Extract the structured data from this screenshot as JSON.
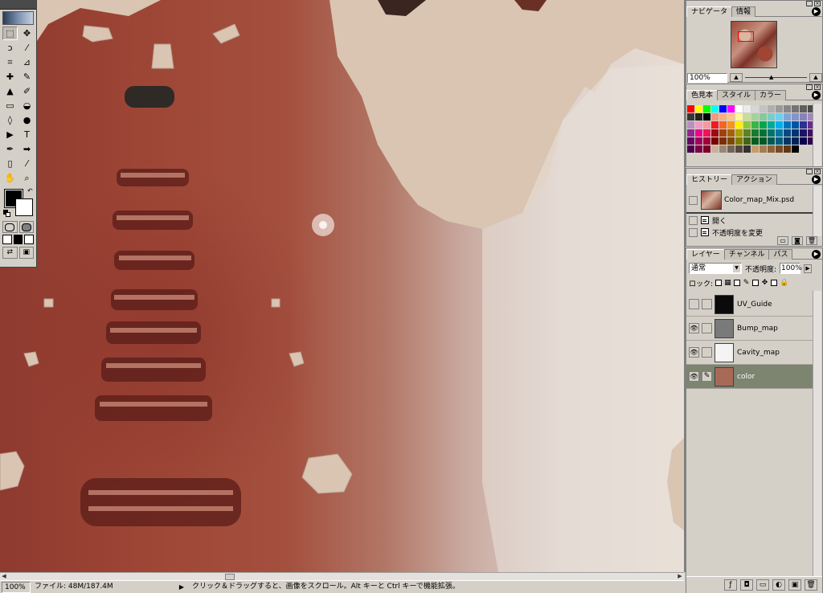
{
  "status": {
    "zoom": "100%",
    "file_info": "ファイル: 48M/187.4M",
    "message": "クリック＆ドラッグすると、画像をスクロール。Alt キーと Ctrl キーで機能拡張。"
  },
  "toolbox": {
    "tools": [
      {
        "icon": "marquee-icon",
        "glyph": "⬚"
      },
      {
        "icon": "move-icon",
        "glyph": "✥"
      },
      {
        "icon": "lasso-icon",
        "glyph": "ↄ"
      },
      {
        "icon": "magic-wand-icon",
        "glyph": "⁄"
      },
      {
        "icon": "crop-icon",
        "glyph": "⌗"
      },
      {
        "icon": "slice-icon",
        "glyph": "⊿"
      },
      {
        "icon": "healing-brush-icon",
        "glyph": "✚"
      },
      {
        "icon": "brush-icon",
        "glyph": "✎"
      },
      {
        "icon": "stamp-icon",
        "glyph": "▲"
      },
      {
        "icon": "history-brush-icon",
        "glyph": "✐"
      },
      {
        "icon": "eraser-icon",
        "glyph": "▭"
      },
      {
        "icon": "bucket-icon",
        "glyph": "◒"
      },
      {
        "icon": "blur-icon",
        "glyph": "◊"
      },
      {
        "icon": "dodge-icon",
        "glyph": "●"
      },
      {
        "icon": "path-select-icon",
        "glyph": "▶"
      },
      {
        "icon": "type-icon",
        "glyph": "T"
      },
      {
        "icon": "pen-icon",
        "glyph": "✒"
      },
      {
        "icon": "shape-icon",
        "glyph": "➡"
      },
      {
        "icon": "notes-icon",
        "glyph": "▯"
      },
      {
        "icon": "eyedropper-icon",
        "glyph": "⁄"
      },
      {
        "icon": "hand-icon",
        "glyph": "✋"
      },
      {
        "icon": "zoom-icon",
        "glyph": "⌕"
      }
    ]
  },
  "navigator": {
    "tabs": [
      "ナビゲータ",
      "情報"
    ],
    "zoom": "100%"
  },
  "swatches": {
    "tabs": [
      "色見本",
      "スタイル",
      "カラー"
    ],
    "colors": [
      "#ff0000",
      "#ffff00",
      "#00ff00",
      "#00ffff",
      "#0000ff",
      "#ff00ff",
      "#ffffff",
      "#ebebeb",
      "#d7d7d7",
      "#c3c3c3",
      "#afafaf",
      "#9b9b9b",
      "#878787",
      "#737373",
      "#5f5f5f",
      "#4b4b4b",
      "#373737",
      "#232323",
      "#000000",
      "#f7977a",
      "#f9ad81",
      "#fdc68a",
      "#fff79a",
      "#c4df9b",
      "#a2d39c",
      "#82ca9d",
      "#7bcdc8",
      "#6ecff6",
      "#7ea7d8",
      "#8493ca",
      "#8882be",
      "#a187be",
      "#bc8dbf",
      "#f49ac2",
      "#f6989d",
      "#ed1c24",
      "#f26522",
      "#f7941d",
      "#fff200",
      "#8dc73f",
      "#39b54a",
      "#00a651",
      "#00a99d",
      "#00aeef",
      "#0072bc",
      "#0054a6",
      "#2e3192",
      "#662d91",
      "#92278f",
      "#ec008c",
      "#ed145b",
      "#9e0b0f",
      "#a0410d",
      "#a36209",
      "#aba000",
      "#598527",
      "#1a7b30",
      "#007236",
      "#00746b",
      "#0076a3",
      "#004b80",
      "#003471",
      "#1b1464",
      "#440e62",
      "#630460",
      "#9e005d",
      "#9e0039",
      "#790000",
      "#7b2e00",
      "#7d4900",
      "#827b00",
      "#406618",
      "#005e20",
      "#005826",
      "#005952",
      "#005b7f",
      "#003663",
      "#002157",
      "#0d004c",
      "#32004b",
      "#4b0049",
      "#7b0046",
      "#7a0026",
      "#c7b299",
      "#998675",
      "#736357",
      "#534741",
      "#37302d",
      "#c69c6d",
      "#a67c52",
      "#8c6239",
      "#754c24",
      "#603913",
      "#000000"
    ]
  },
  "history": {
    "tabs": [
      "ヒストリー",
      "アクション"
    ],
    "snapshot": "Color_map_Mix.psd",
    "items": [
      "開く",
      "不透明度を変更"
    ]
  },
  "layers": {
    "tabs": [
      "レイヤー",
      "チャンネル",
      "パス"
    ],
    "blend_mode": "通常",
    "opacity_label": "不透明度:",
    "opacity": "100%",
    "lock_label": "ロック:",
    "items": [
      {
        "name": "UV_Guide",
        "visible": false,
        "thumb": "#0a0a0a",
        "active": false
      },
      {
        "name": "Bump_map",
        "visible": true,
        "thumb": "#7a7a7a",
        "active": false
      },
      {
        "name": "Cavity_map",
        "visible": true,
        "thumb": "#f4f4f4",
        "active": false
      },
      {
        "name": "color",
        "visible": true,
        "thumb": "#a86a56",
        "active": true
      }
    ]
  }
}
